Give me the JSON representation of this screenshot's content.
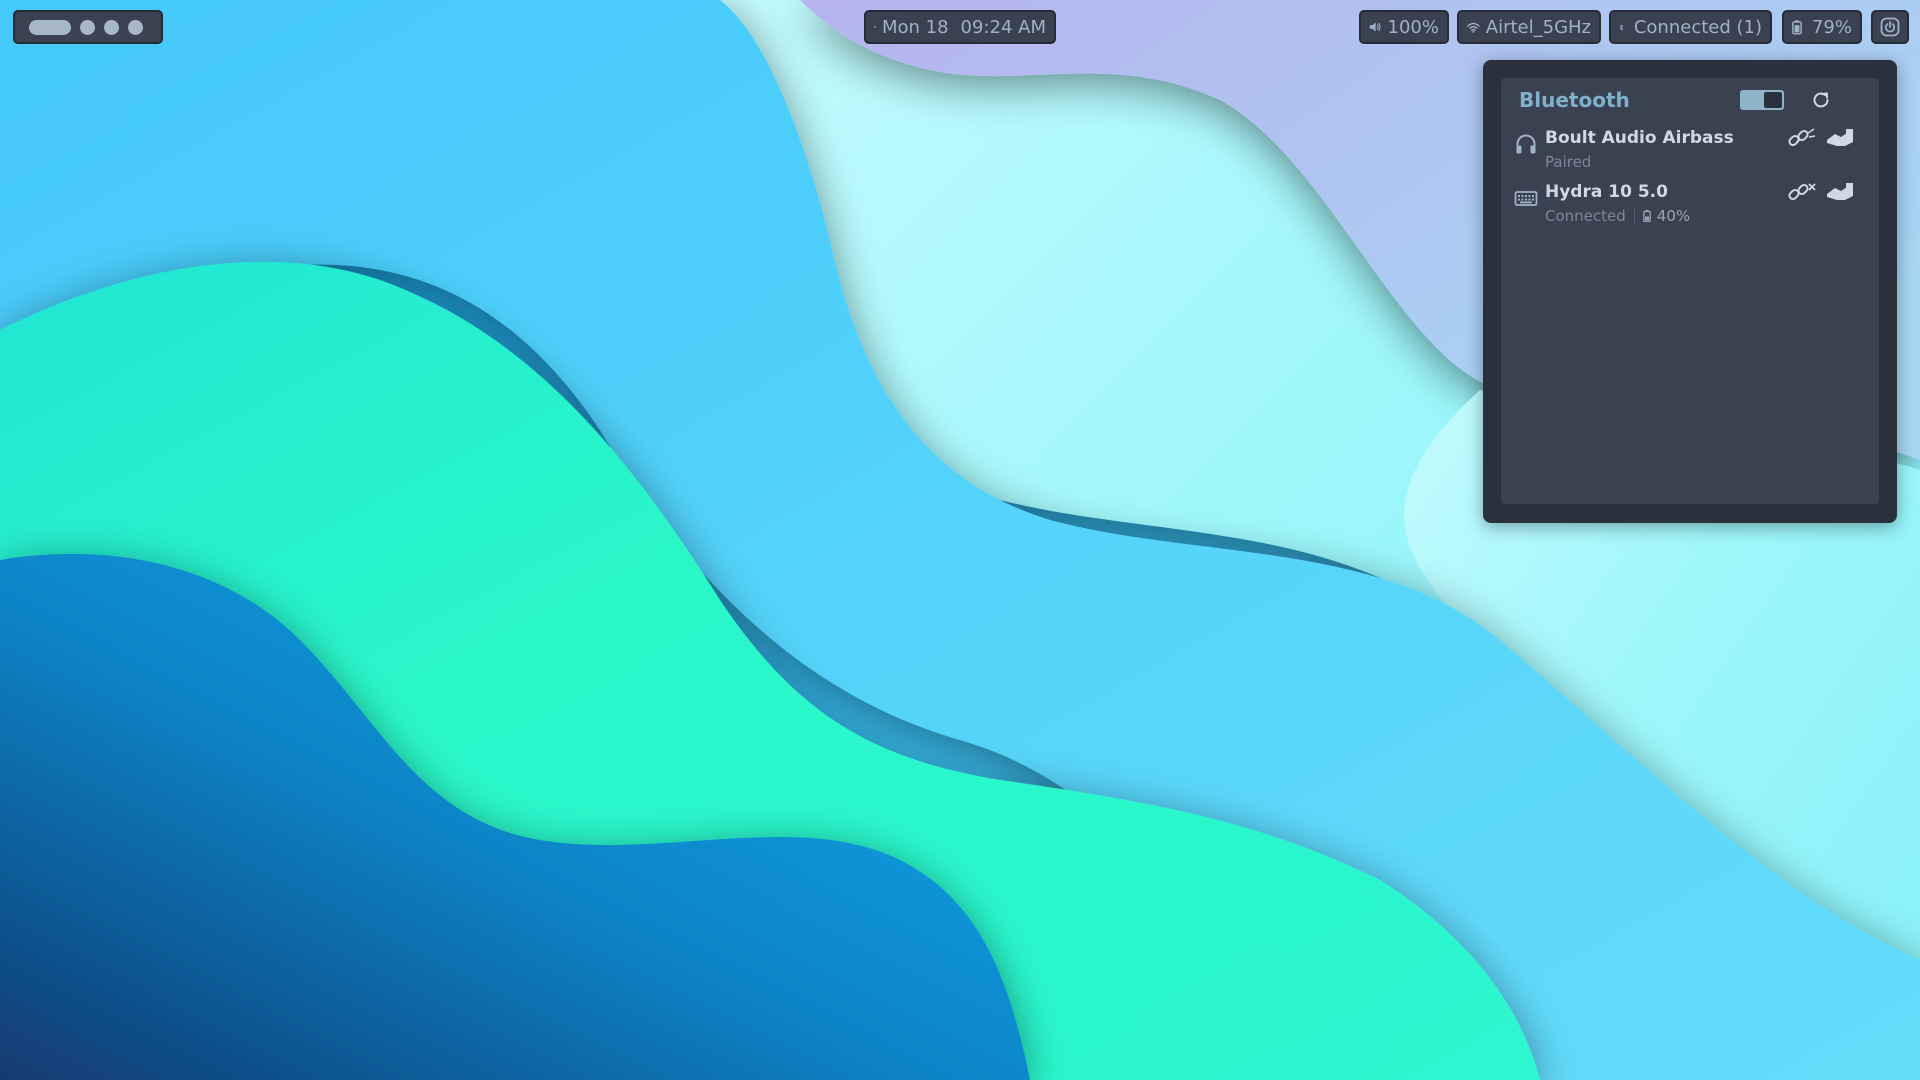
{
  "topbar": {
    "workspaces": {
      "count": 4,
      "active_index": 0
    },
    "clock": {
      "date": "Mon 18",
      "time": "09:24 AM",
      "icon": "calendar-icon"
    },
    "volume": {
      "value": "100%",
      "icon": "speaker-icon"
    },
    "wifi": {
      "ssid": "Airtel_5GHz",
      "icon": "wifi-icon"
    },
    "bluetooth": {
      "status": "Connected (1)",
      "icon": "bluetooth-icon"
    },
    "battery": {
      "value": "79%",
      "icon": "battery-icon"
    },
    "settings": {
      "icon": "power-settings-icon"
    }
  },
  "bluetooth_panel": {
    "title": "Bluetooth",
    "enabled": true,
    "refresh_icon": "refresh-icon",
    "devices": [
      {
        "name": "Boult Audio Airbass",
        "status": "Paired",
        "icon": "headphones-icon",
        "battery": null
      },
      {
        "name": "Hydra 10 5.0",
        "status": "Connected",
        "icon": "keyboard-icon",
        "battery": "40%"
      }
    ]
  },
  "colors": {
    "bar_bg": "#3a4150",
    "bar_border": "#262b36",
    "bar_text": "#9fb2c8",
    "panel_bg": "#2b313c",
    "panel_title": "#7fb0cc",
    "device_name": "#cfd8e3",
    "device_status": "#7b8797"
  }
}
